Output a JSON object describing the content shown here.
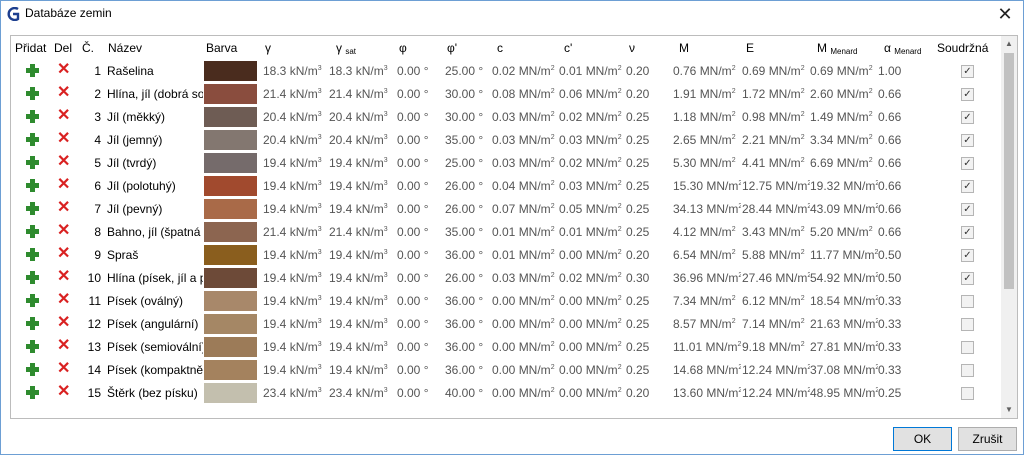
{
  "window": {
    "title": "Databáze zemin"
  },
  "dialog": {
    "ok_label": "OK",
    "cancel_label": "Zrušit"
  },
  "headers": {
    "add": "Přidat",
    "del": "Del",
    "num": "Č.",
    "name": "Název",
    "color": "Barva",
    "gamma": "γ",
    "gamma_sat": "γ",
    "gamma_sat_sub": "sat",
    "phi": "φ",
    "phi_eff": "φ'",
    "c": "c",
    "c_eff": "c'",
    "nu": "ν",
    "m": "M",
    "e": "E",
    "m_menard": "M",
    "m_menard_sub": "Menard",
    "alpha_menard": "α",
    "alpha_menard_sub": "Menard",
    "cohesive": "Soudržná"
  },
  "rows": [
    {
      "num": "1",
      "name": "Rašelina",
      "color": "#4a2c1e",
      "gamma": "18.3 kN/m",
      "gamma_sat": "18.3 kN/m",
      "phi": "0.00 °",
      "phi_eff": "25.00 °",
      "c": "0.02 MN/m",
      "c_eff": "0.01 MN/m",
      "nu": "0.20",
      "m": "0.76 MN/m",
      "e": "0.69 MN/m",
      "m_menard": "0.69 MN/m",
      "alpha": "1.00",
      "cohesive": true
    },
    {
      "num": "2",
      "name": "Hlína, jíl (dobrá sou",
      "color": "#8a4d3e",
      "gamma": "21.4 kN/m",
      "gamma_sat": "21.4 kN/m",
      "phi": "0.00 °",
      "phi_eff": "30.00 °",
      "c": "0.08 MN/m",
      "c_eff": "0.06 MN/m",
      "nu": "0.20",
      "m": "1.91 MN/m",
      "e": "1.72 MN/m",
      "m_menard": "2.60 MN/m",
      "alpha": "0.66",
      "cohesive": true
    },
    {
      "num": "3",
      "name": "Jíl (měkký)",
      "color": "#6e5c54",
      "gamma": "20.4 kN/m",
      "gamma_sat": "20.4 kN/m",
      "phi": "0.00 °",
      "phi_eff": "30.00 °",
      "c": "0.03 MN/m",
      "c_eff": "0.02 MN/m",
      "nu": "0.25",
      "m": "1.18 MN/m",
      "e": "0.98 MN/m",
      "m_menard": "1.49 MN/m",
      "alpha": "0.66",
      "cohesive": true
    },
    {
      "num": "4",
      "name": "Jíl (jemný)",
      "color": "#837770",
      "gamma": "20.4 kN/m",
      "gamma_sat": "20.4 kN/m",
      "phi": "0.00 °",
      "phi_eff": "35.00 °",
      "c": "0.03 MN/m",
      "c_eff": "0.03 MN/m",
      "nu": "0.25",
      "m": "2.65 MN/m",
      "e": "2.21 MN/m",
      "m_menard": "3.34 MN/m",
      "alpha": "0.66",
      "cohesive": true
    },
    {
      "num": "5",
      "name": "Jíl (tvrdý)",
      "color": "#756b6b",
      "gamma": "19.4 kN/m",
      "gamma_sat": "19.4 kN/m",
      "phi": "0.00 °",
      "phi_eff": "25.00 °",
      "c": "0.03 MN/m",
      "c_eff": "0.02 MN/m",
      "nu": "0.25",
      "m": "5.30 MN/m",
      "e": "4.41 MN/m",
      "m_menard": "6.69 MN/m",
      "alpha": "0.66",
      "cohesive": true
    },
    {
      "num": "6",
      "name": "Jíl (polotuhý)",
      "color": "#a14a2e",
      "gamma": "19.4 kN/m",
      "gamma_sat": "19.4 kN/m",
      "phi": "0.00 °",
      "phi_eff": "26.00 °",
      "c": "0.04 MN/m",
      "c_eff": "0.03 MN/m",
      "nu": "0.25",
      "m": "15.30 MN/m",
      "e": "12.75 MN/m",
      "m_menard": "19.32 MN/m",
      "alpha": "0.66",
      "cohesive": true
    },
    {
      "num": "7",
      "name": "Jíl (pevný)",
      "color": "#a96a48",
      "gamma": "19.4 kN/m",
      "gamma_sat": "19.4 kN/m",
      "phi": "0.00 °",
      "phi_eff": "26.00 °",
      "c": "0.07 MN/m",
      "c_eff": "0.05 MN/m",
      "nu": "0.25",
      "m": "34.13 MN/m",
      "e": "28.44 MN/m",
      "m_menard": "43.09 MN/m",
      "alpha": "0.66",
      "cohesive": true
    },
    {
      "num": "8",
      "name": "Bahno, jíl (špatná s",
      "color": "#8c6550",
      "gamma": "21.4 kN/m",
      "gamma_sat": "21.4 kN/m",
      "phi": "0.00 °",
      "phi_eff": "35.00 °",
      "c": "0.01 MN/m",
      "c_eff": "0.01 MN/m",
      "nu": "0.25",
      "m": "4.12 MN/m",
      "e": "3.43 MN/m",
      "m_menard": "5.20 MN/m",
      "alpha": "0.66",
      "cohesive": true
    },
    {
      "num": "9",
      "name": "Spraš",
      "color": "#8a5e1e",
      "gamma": "19.4 kN/m",
      "gamma_sat": "19.4 kN/m",
      "phi": "0.00 °",
      "phi_eff": "36.00 °",
      "c": "0.01 MN/m",
      "c_eff": "0.00 MN/m",
      "nu": "0.20",
      "m": "6.54 MN/m",
      "e": "5.88 MN/m",
      "m_menard": "11.77 MN/m",
      "alpha": "0.50",
      "cohesive": true
    },
    {
      "num": "10",
      "name": "Hlína (písek, jíl a pr",
      "color": "#6d4a38",
      "gamma": "19.4 kN/m",
      "gamma_sat": "19.4 kN/m",
      "phi": "0.00 °",
      "phi_eff": "26.00 °",
      "c": "0.03 MN/m",
      "c_eff": "0.02 MN/m",
      "nu": "0.30",
      "m": "36.96 MN/m",
      "e": "27.46 MN/m",
      "m_menard": "54.92 MN/m",
      "alpha": "0.50",
      "cohesive": true
    },
    {
      "num": "11",
      "name": "Písek (oválný)",
      "color": "#a8886a",
      "gamma": "19.4 kN/m",
      "gamma_sat": "19.4 kN/m",
      "phi": "0.00 °",
      "phi_eff": "36.00 °",
      "c": "0.00 MN/m",
      "c_eff": "0.00 MN/m",
      "nu": "0.25",
      "m": "7.34 MN/m",
      "e": "6.12 MN/m",
      "m_menard": "18.54 MN/m",
      "alpha": "0.33",
      "cohesive": false
    },
    {
      "num": "12",
      "name": "Písek (angulární)",
      "color": "#a58765",
      "gamma": "19.4 kN/m",
      "gamma_sat": "19.4 kN/m",
      "phi": "0.00 °",
      "phi_eff": "36.00 °",
      "c": "0.00 MN/m",
      "c_eff": "0.00 MN/m",
      "nu": "0.25",
      "m": "8.57 MN/m",
      "e": "7.14 MN/m",
      "m_menard": "21.63 MN/m",
      "alpha": "0.33",
      "cohesive": false
    },
    {
      "num": "13",
      "name": "Písek (semiovální)",
      "color": "#9c7b58",
      "gamma": "19.4 kN/m",
      "gamma_sat": "19.4 kN/m",
      "phi": "0.00 °",
      "phi_eff": "36.00 °",
      "c": "0.00 MN/m",
      "c_eff": "0.00 MN/m",
      "nu": "0.25",
      "m": "11.01 MN/m",
      "e": "9.18 MN/m",
      "m_menard": "27.81 MN/m",
      "alpha": "0.33",
      "cohesive": false
    },
    {
      "num": "14",
      "name": "Písek (kompaktně",
      "color": "#a4825e",
      "gamma": "19.4 kN/m",
      "gamma_sat": "19.4 kN/m",
      "phi": "0.00 °",
      "phi_eff": "36.00 °",
      "c": "0.00 MN/m",
      "c_eff": "0.00 MN/m",
      "nu": "0.25",
      "m": "14.68 MN/m",
      "e": "12.24 MN/m",
      "m_menard": "37.08 MN/m",
      "alpha": "0.33",
      "cohesive": false
    },
    {
      "num": "15",
      "name": "Štěrk (bez písku)",
      "color": "#c3bfae",
      "gamma": "23.4 kN/m",
      "gamma_sat": "23.4 kN/m",
      "phi": "0.00 °",
      "phi_eff": "40.00 °",
      "c": "0.00 MN/m",
      "c_eff": "0.00 MN/m",
      "nu": "0.20",
      "m": "13.60 MN/m",
      "e": "12.24 MN/m",
      "m_menard": "48.95 MN/m",
      "alpha": "0.25",
      "cohesive": false
    }
  ],
  "icons": {
    "add": "plus-icon",
    "delete": "delete-x-icon",
    "close": "close-icon",
    "app": "geo5-logo-icon"
  },
  "colors": {
    "add_icon": "#2e8b2e",
    "delete_icon": "#d92121",
    "accent": "#0078d7"
  }
}
